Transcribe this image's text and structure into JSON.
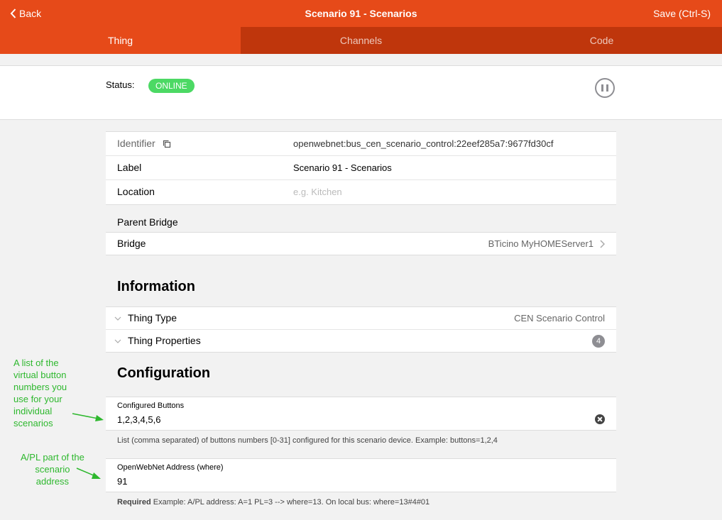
{
  "navbar": {
    "back_label": "Back",
    "title": "Scenario 91 - Scenarios",
    "save_label": "Save (Ctrl-S)"
  },
  "tabs": [
    {
      "label": "Thing"
    },
    {
      "label": "Channels"
    },
    {
      "label": "Code"
    }
  ],
  "status": {
    "label": "Status:",
    "value": "ONLINE"
  },
  "details": {
    "identifier_label": "Identifier",
    "identifier_value": "openwebnet:bus_cen_scenario_control:22eef285a7:9677fd30cf",
    "label_label": "Label",
    "label_value": "Scenario 91 - Scenarios",
    "location_label": "Location",
    "location_placeholder": "e.g. Kitchen"
  },
  "parent_bridge": {
    "heading": "Parent Bridge",
    "bridge_label": "Bridge",
    "bridge_value": "BTicino MyHOMEServer1"
  },
  "information": {
    "title": "Information",
    "thing_type_label": "Thing Type",
    "thing_type_value": "CEN Scenario Control",
    "thing_properties_label": "Thing Properties",
    "thing_properties_count": "4"
  },
  "configuration": {
    "title": "Configuration",
    "buttons_label": "Configured Buttons",
    "buttons_value": "1,2,3,4,5,6",
    "buttons_hint": "List (comma separated) of buttons numbers [0-31] configured for this scenario device. Example: buttons=1,2,4",
    "where_label": "OpenWebNet Address (where)",
    "where_value": "91",
    "where_required": "Required",
    "where_hint": " Example: A/PL address: A=1 PL=3 --> where=13. On local bus: where=13#4#01"
  },
  "annotations": {
    "buttons_note": [
      "A list of the",
      "virtual button",
      "numbers you",
      "use for your",
      "individual",
      "scenarios"
    ],
    "address_note": [
      "A/PL part of the",
      "scenario",
      "address"
    ]
  },
  "colors": {
    "accent": "#e64a19",
    "tab_bar": "#bf360c",
    "online": "#4cd964",
    "annotation": "#2eb82e"
  }
}
